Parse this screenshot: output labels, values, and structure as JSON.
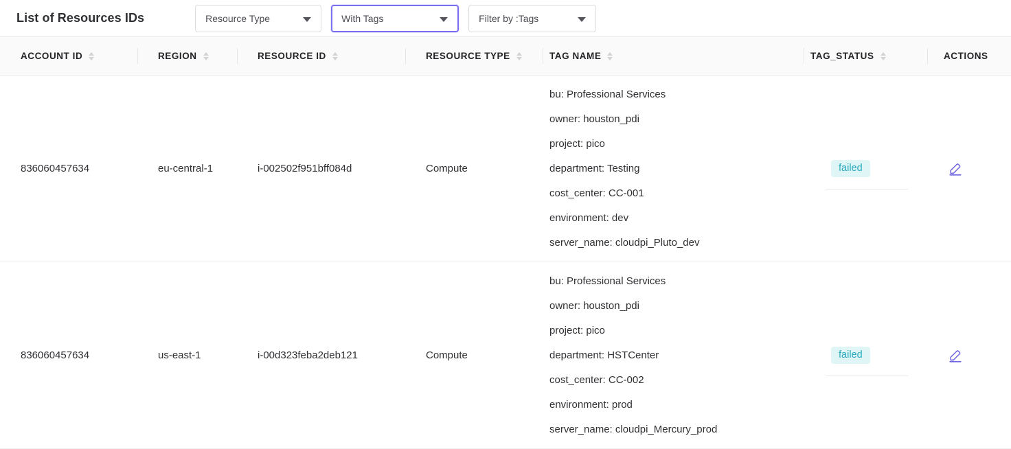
{
  "toolbar": {
    "title": "List of Resources IDs",
    "filters": [
      {
        "name": "resource-type",
        "label": "Resource Type",
        "focused": false
      },
      {
        "name": "with-tags",
        "label": "With Tags",
        "focused": true
      },
      {
        "name": "filter-by-tags",
        "label": "Filter by :Tags",
        "focused": false
      }
    ]
  },
  "colors": {
    "accent": "#7a6ff0",
    "badge_text": "#26a9bd",
    "badge_background": "#e0f5f6",
    "header_background": "#fafafa",
    "edit_icon": "#6c63e0"
  },
  "table": {
    "columns": [
      {
        "key": "account_id",
        "label": "ACCOUNT ID",
        "sortable": true,
        "divided": false
      },
      {
        "key": "region",
        "label": "REGION",
        "sortable": true,
        "divided": true
      },
      {
        "key": "resource_id",
        "label": "RESOURCE ID",
        "sortable": true,
        "divided": true
      },
      {
        "key": "resource_type",
        "label": "RESOURCE TYPE",
        "sortable": true,
        "divided": true
      },
      {
        "key": "tag_name",
        "label": "TAG NAME",
        "sortable": true,
        "divided": true
      },
      {
        "key": "tag_status",
        "label": "TAG_STATUS",
        "sortable": true,
        "divided": true
      },
      {
        "key": "actions",
        "label": "ACTIONS",
        "sortable": false,
        "divided": true
      }
    ],
    "rows": [
      {
        "account_id": "836060457634",
        "region": "eu-central-1",
        "resource_id": "i-002502f951bff084d",
        "resource_type": "Compute",
        "tags": [
          "bu: Professional Services",
          "owner: houston_pdi",
          "project: pico",
          "department: Testing",
          "cost_center: CC-001",
          "environment: dev",
          "server_name: cloudpi_Pluto_dev"
        ],
        "tag_status": "failed",
        "action": "edit"
      },
      {
        "account_id": "836060457634",
        "region": "us-east-1",
        "resource_id": "i-00d323feba2deb121",
        "resource_type": "Compute",
        "tags": [
          "bu: Professional Services",
          "owner: houston_pdi",
          "project: pico",
          "department: HSTCenter",
          "cost_center: CC-002",
          "environment: prod",
          "server_name: cloudpi_Mercury_prod"
        ],
        "tag_status": "failed",
        "action": "edit"
      }
    ]
  }
}
